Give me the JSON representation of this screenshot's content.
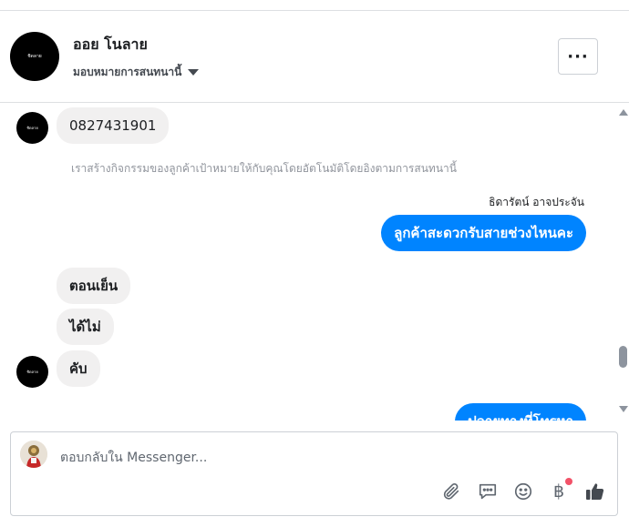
{
  "header": {
    "avatar_text": "ชิดลาย",
    "name": "ออย โนลาย",
    "assign_label": "มอบหมายการสนทนานี้",
    "more_label": "···"
  },
  "thread": {
    "messages": [
      {
        "direction": "in",
        "text": "0827431901",
        "avatar_text": "ชิดลาย"
      },
      {
        "direction": "system",
        "text": "เราสร้างกิจกรรมของลูกค้าเป้าหมายให้กับคุณโดยอัตโนมัติโดยอิงตามการสนทนานี้"
      },
      {
        "direction": "sender",
        "text": "ธิดารัตน์ อาจประจัน"
      },
      {
        "direction": "out",
        "text": "ลูกค้าสะดวกรับสายช่วงไหนคะ"
      },
      {
        "direction": "in",
        "text": "ตอนเย็น"
      },
      {
        "direction": "in",
        "text": "ได้ไม่"
      },
      {
        "direction": "in",
        "text": "คับ",
        "avatar_text": "ชิดลาย"
      },
      {
        "direction": "out",
        "text": "ปลายทางที่โทรหา"
      }
    ]
  },
  "composer": {
    "placeholder": "ตอบกลับใน Messenger...",
    "value": "",
    "currency_symbol": "฿"
  },
  "colors": {
    "outgoing_bubble": "#0084ff",
    "incoming_bubble": "#f1f0f0",
    "notification_dot": "#f25268"
  },
  "icons": [
    "paperclip-icon",
    "saved-reply-icon",
    "emoji-icon",
    "baht-icon",
    "like-icon",
    "chevron-down-icon",
    "more-icon"
  ]
}
